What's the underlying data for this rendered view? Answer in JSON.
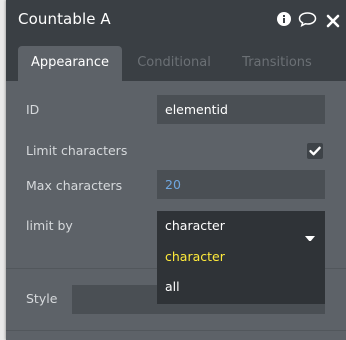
{
  "header": {
    "title": "Countable A",
    "icons": [
      "info-icon",
      "comment-icon",
      "close-icon"
    ]
  },
  "tabs": [
    {
      "label": "Appearance",
      "active": true
    },
    {
      "label": "Conditional",
      "active": false
    },
    {
      "label": "Transitions",
      "active": false
    }
  ],
  "form": {
    "id_label": "ID",
    "id_value": "elementid",
    "limit_label": "Limit characters",
    "limit_checked": true,
    "max_label": "Max characters",
    "max_value": "20",
    "limitby_label": "limit by",
    "limitby_value": "character",
    "options": [
      "character",
      "all"
    ],
    "style_label": "Style"
  },
  "colors": {
    "panel": "#5d6268",
    "header": "#3a3f44",
    "highlight_option": "#ffeb3b",
    "number_value": "#6fa7e0"
  }
}
